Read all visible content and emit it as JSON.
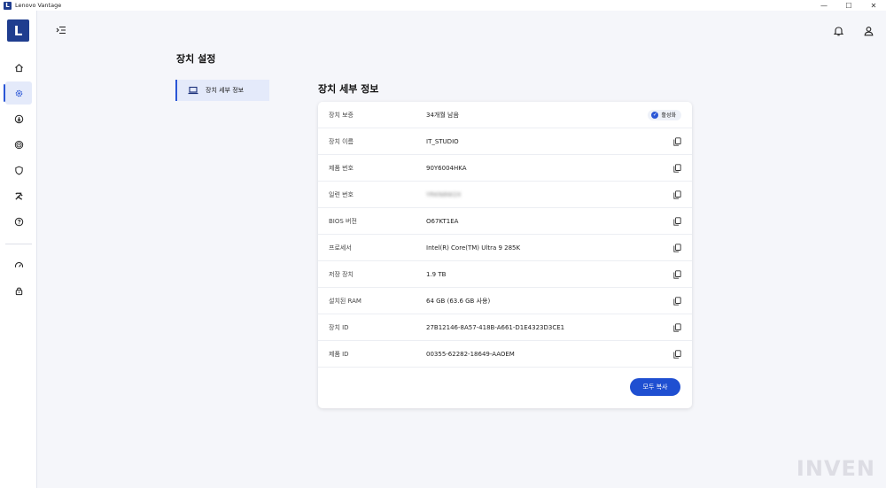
{
  "window": {
    "title": "Lenovo Vantage",
    "logo_letter": "L",
    "minimize": "—",
    "maximize": "☐",
    "close": "✕"
  },
  "rail": {
    "brand_letter": "L",
    "items": [
      {
        "name": "home",
        "active": false
      },
      {
        "name": "device-settings",
        "active": true
      },
      {
        "name": "downloads",
        "active": false
      },
      {
        "name": "network",
        "active": false
      },
      {
        "name": "security",
        "active": false
      },
      {
        "name": "tools",
        "active": false
      },
      {
        "name": "help",
        "active": false
      },
      {
        "name": "performance",
        "active": false
      },
      {
        "name": "lock",
        "active": false
      }
    ]
  },
  "page": {
    "title": "장치 설정",
    "subnav_label": "장치 세부 정보",
    "section_title": "장치 세부 정보"
  },
  "details": {
    "rows": [
      {
        "label": "장치 보증",
        "value": "34개월 남음",
        "badge": "활성화"
      },
      {
        "label": "장치 이름",
        "value": "IT_STUDIO"
      },
      {
        "label": "제품 번호",
        "value": "90Y6004HKA"
      },
      {
        "label": "일련 번호",
        "value": "YRKN8W2X"
      },
      {
        "label": "BIOS 버전",
        "value": "O67KT1EA"
      },
      {
        "label": "프로세서",
        "value": "Intel(R) Core(TM) Ultra 9 285K"
      },
      {
        "label": "저장 장치",
        "value": "1.9 TB"
      },
      {
        "label": "설치된 RAM",
        "value": "64 GB (63.6 GB 사용)"
      },
      {
        "label": "장치 ID",
        "value": "27B12146-8A57-418B-A661-D1E4323D3CE1"
      },
      {
        "label": "제품 ID",
        "value": "00355-62282-18649-AAOEM"
      }
    ],
    "copy_all_label": "모두 복사"
  },
  "watermark": "INVEN",
  "colors": {
    "accent": "#1f4fd1",
    "brand": "#1f3d8f",
    "active_bg": "#e4eafa"
  }
}
